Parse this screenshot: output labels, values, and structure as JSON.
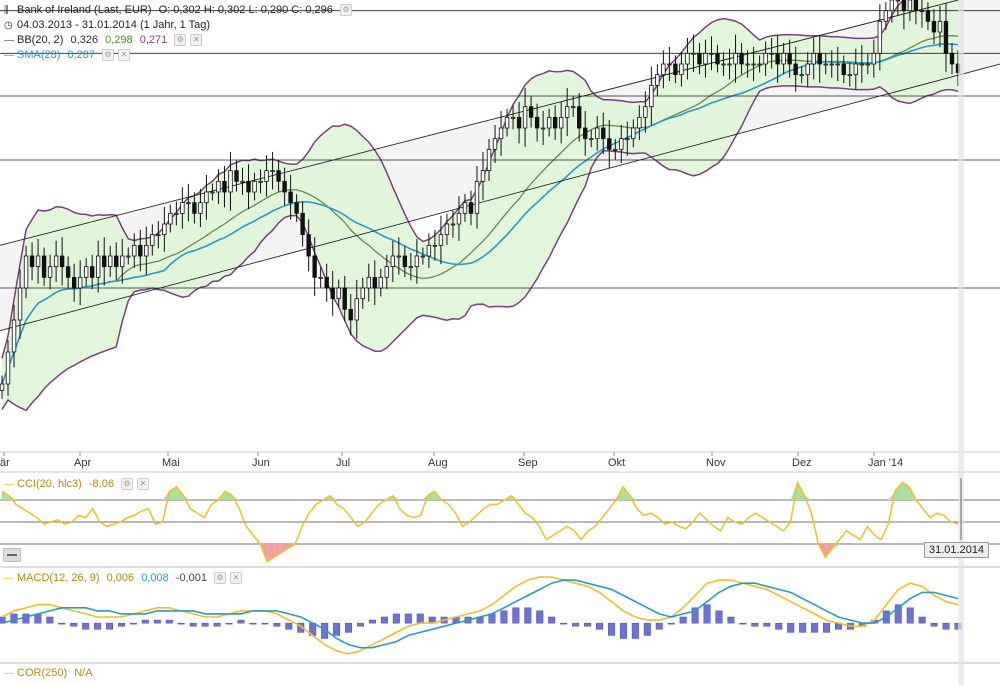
{
  "header": {
    "title": "Bank of Ireland (Last, EUR)",
    "ohlc": "O: 0,302  H: 0,302  L: 0,290  C: 0,296",
    "period": "04.03.2013 - 31.01.2014 (1 Jahr, 1 Tag)",
    "bb_label": "BB(20, 2)",
    "bb_values": [
      "0,326",
      "0,298",
      "0,271"
    ],
    "sma_label": "SMA(28)",
    "sma_value": "0,287"
  },
  "indicators": {
    "cci_label": "CCI(20, hlc3)",
    "cci_value": "-8,06",
    "macd_label": "MACD(12, 26, 9)",
    "macd_values": [
      "0,006",
      "0,008",
      "-0,001"
    ],
    "cor_label": "COR(250)",
    "cor_value": "N/A"
  },
  "cursor_date": "31.01.2014",
  "colors": {
    "bb_fill": "#dff5d8",
    "bb_band": "#7b3f7b",
    "bb_mid": "#6a8a4a",
    "sma": "#2a9ac8",
    "cci": "#f0c020",
    "cci_pos_fill": "#a8e0a0",
    "cci_neg_fill": "#f0a0a0",
    "macd_line": "#f0c020",
    "macd_signal": "#2a9ac8",
    "macd_hist": "#7070d8",
    "channel_fill": "#f4f4f4"
  },
  "chart_data": [
    {
      "type": "line",
      "title": "Bank of Ireland (Last, EUR)",
      "series_type": "candlestick",
      "x_months": [
        "Mär",
        "Apr",
        "Mai",
        "Jun",
        "Jul",
        "Aug",
        "Sep",
        "Okt",
        "Nov",
        "Dez",
        "Jan '14"
      ],
      "x_month_labels_shown": [
        "är",
        "Apr",
        "Mai",
        "Jun",
        "Jul",
        "Aug",
        "Sep",
        "Okt",
        "Nov",
        "Dez",
        "Jan '14"
      ],
      "ylim": [
        0.12,
        0.33
      ],
      "close": [
        0.15,
        0.165,
        0.18,
        0.195,
        0.21,
        0.205,
        0.21,
        0.2,
        0.205,
        0.21,
        0.205,
        0.2,
        0.195,
        0.2,
        0.205,
        0.2,
        0.21,
        0.205,
        0.21,
        0.205,
        0.21,
        0.21,
        0.215,
        0.21,
        0.215,
        0.22,
        0.22,
        0.225,
        0.23,
        0.23,
        0.235,
        0.235,
        0.23,
        0.235,
        0.24,
        0.24,
        0.245,
        0.24,
        0.25,
        0.245,
        0.245,
        0.24,
        0.245,
        0.245,
        0.25,
        0.25,
        0.245,
        0.24,
        0.235,
        0.23,
        0.22,
        0.21,
        0.2,
        0.2,
        0.195,
        0.19,
        0.195,
        0.185,
        0.18,
        0.19,
        0.195,
        0.2,
        0.195,
        0.2,
        0.205,
        0.21,
        0.21,
        0.205,
        0.205,
        0.21,
        0.21,
        0.215,
        0.215,
        0.22,
        0.225,
        0.225,
        0.23,
        0.235,
        0.23,
        0.245,
        0.25,
        0.26,
        0.265,
        0.27,
        0.275,
        0.275,
        0.27,
        0.28,
        0.275,
        0.27,
        0.27,
        0.275,
        0.27,
        0.275,
        0.28,
        0.28,
        0.27,
        0.265,
        0.265,
        0.27,
        0.265,
        0.26,
        0.26,
        0.265,
        0.265,
        0.27,
        0.275,
        0.28,
        0.29,
        0.295,
        0.3,
        0.3,
        0.295,
        0.3,
        0.305,
        0.305,
        0.3,
        0.305,
        0.305,
        0.3,
        0.3,
        0.3,
        0.305,
        0.3,
        0.3,
        0.3,
        0.3,
        0.305,
        0.305,
        0.3,
        0.305,
        0.3,
        0.295,
        0.295,
        0.3,
        0.305,
        0.3,
        0.3,
        0.3,
        0.3,
        0.295,
        0.295,
        0.3,
        0.3,
        0.3,
        0.305,
        0.32,
        0.325,
        0.33,
        0.33,
        0.325,
        0.33,
        0.325,
        0.325,
        0.32,
        0.315,
        0.32,
        0.305,
        0.3,
        0.296
      ],
      "bollinger": {
        "name": "BB(20, 2)",
        "upper": 0.326,
        "middle": 0.298,
        "lower": 0.271
      },
      "sma": {
        "name": "SMA(28)",
        "last": 0.287
      },
      "horizontal_lines": [
        0.325,
        0.305,
        0.285,
        0.255,
        0.195
      ],
      "trend_channel": {
        "upper": [
          0.215,
          0.335
        ],
        "lower": [
          0.175,
          0.3
        ]
      }
    },
    {
      "type": "area",
      "title": "CCI(20, hlc3)",
      "last": -8.06,
      "ylim": [
        -200,
        200
      ],
      "reference_lines": [
        100,
        0,
        -100
      ],
      "values": [
        140,
        120,
        80,
        60,
        40,
        20,
        -10,
        0,
        10,
        -10,
        0,
        30,
        20,
        60,
        0,
        -20,
        -10,
        0,
        20,
        30,
        50,
        60,
        -10,
        0,
        140,
        160,
        120,
        60,
        40,
        20,
        80,
        100,
        140,
        120,
        60,
        -20,
        -60,
        -100,
        -180,
        -160,
        -140,
        -120,
        -100,
        -20,
        40,
        80,
        100,
        120,
        80,
        60,
        20,
        -20,
        0,
        40,
        80,
        100,
        120,
        60,
        30,
        20,
        30,
        120,
        140,
        100,
        80,
        40,
        -20,
        0,
        30,
        60,
        80,
        80,
        100,
        120,
        80,
        40,
        20,
        -20,
        -80,
        -60,
        -40,
        -20,
        -40,
        -80,
        -40,
        -20,
        20,
        60,
        100,
        160,
        120,
        60,
        30,
        40,
        20,
        -10,
        0,
        -20,
        -30,
        0,
        40,
        10,
        -20,
        -40,
        20,
        0,
        -10,
        20,
        40,
        20,
        0,
        -20,
        -40,
        0,
        180,
        120,
        40,
        -100,
        -160,
        -120,
        -80,
        -40,
        -60,
        -80,
        -20,
        -60,
        -80,
        -10,
        140,
        180,
        160,
        100,
        60,
        20,
        40,
        30,
        0,
        -8
      ]
    },
    {
      "type": "line",
      "title": "MACD(12, 26, 9)",
      "ylim": [
        -0.012,
        0.016
      ],
      "series": [
        {
          "name": "MACD",
          "last": 0.006,
          "values": [
            0.002,
            0.004,
            0.005,
            0.006,
            0.006,
            0.005,
            0.004,
            0.003,
            0.002,
            0.002,
            0.002,
            0.003,
            0.004,
            0.005,
            0.005,
            0.004,
            0.003,
            0.002,
            0.002,
            0.003,
            0.004,
            0.004,
            0.004,
            0.003,
            0.001,
            -0.001,
            -0.004,
            -0.007,
            -0.009,
            -0.01,
            -0.009,
            -0.007,
            -0.005,
            -0.003,
            -0.001,
            0.0,
            0.0,
            0.001,
            0.002,
            0.003,
            0.004,
            0.006,
            0.009,
            0.012,
            0.014,
            0.015,
            0.015,
            0.014,
            0.013,
            0.012,
            0.01,
            0.007,
            0.004,
            0.002,
            0.001,
            0.001,
            0.002,
            0.005,
            0.009,
            0.013,
            0.014,
            0.014,
            0.013,
            0.012,
            0.011,
            0.009,
            0.007,
            0.005,
            0.003,
            0.001,
            0.0,
            -0.001,
            -0.001,
            0.001,
            0.006,
            0.011,
            0.013,
            0.012,
            0.009,
            0.007,
            0.006
          ]
        },
        {
          "name": "Signal",
          "last": 0.008,
          "values": [
            0.0,
            0.001,
            0.002,
            0.003,
            0.004,
            0.005,
            0.005,
            0.005,
            0.004,
            0.004,
            0.003,
            0.003,
            0.003,
            0.004,
            0.004,
            0.004,
            0.004,
            0.003,
            0.003,
            0.003,
            0.003,
            0.004,
            0.004,
            0.004,
            0.003,
            0.002,
            0.0,
            -0.002,
            -0.005,
            -0.007,
            -0.008,
            -0.008,
            -0.007,
            -0.006,
            -0.004,
            -0.003,
            -0.002,
            -0.001,
            0.0,
            0.001,
            0.002,
            0.003,
            0.005,
            0.007,
            0.009,
            0.011,
            0.013,
            0.014,
            0.014,
            0.013,
            0.012,
            0.011,
            0.009,
            0.007,
            0.005,
            0.003,
            0.002,
            0.003,
            0.004,
            0.007,
            0.01,
            0.012,
            0.013,
            0.013,
            0.012,
            0.011,
            0.01,
            0.008,
            0.006,
            0.004,
            0.002,
            0.001,
            0.0,
            0.0,
            0.002,
            0.005,
            0.008,
            0.01,
            0.01,
            0.009,
            0.008
          ]
        },
        {
          "name": "Histogram",
          "last": -0.001,
          "values": [
            0.002,
            0.003,
            0.003,
            0.003,
            0.002,
            0.0,
            -0.001,
            -0.002,
            -0.002,
            -0.002,
            -0.001,
            0.0,
            0.001,
            0.001,
            0.001,
            0.0,
            -0.001,
            -0.001,
            -0.001,
            0.0,
            0.001,
            0.0,
            0.0,
            -0.001,
            -0.002,
            -0.003,
            -0.004,
            -0.005,
            -0.004,
            -0.003,
            -0.001,
            0.001,
            0.002,
            0.003,
            0.003,
            0.003,
            0.002,
            0.002,
            0.002,
            0.002,
            0.002,
            0.003,
            0.004,
            0.005,
            0.005,
            0.004,
            0.002,
            0.0,
            -0.001,
            -0.001,
            -0.002,
            -0.004,
            -0.005,
            -0.005,
            -0.004,
            -0.002,
            0.0,
            0.002,
            0.005,
            0.006,
            0.004,
            0.002,
            0.0,
            -0.001,
            -0.001,
            -0.002,
            -0.003,
            -0.003,
            -0.003,
            -0.003,
            -0.002,
            -0.002,
            -0.001,
            0.001,
            0.004,
            0.006,
            0.005,
            0.002,
            -0.001,
            -0.002,
            -0.002
          ]
        }
      ]
    }
  ]
}
